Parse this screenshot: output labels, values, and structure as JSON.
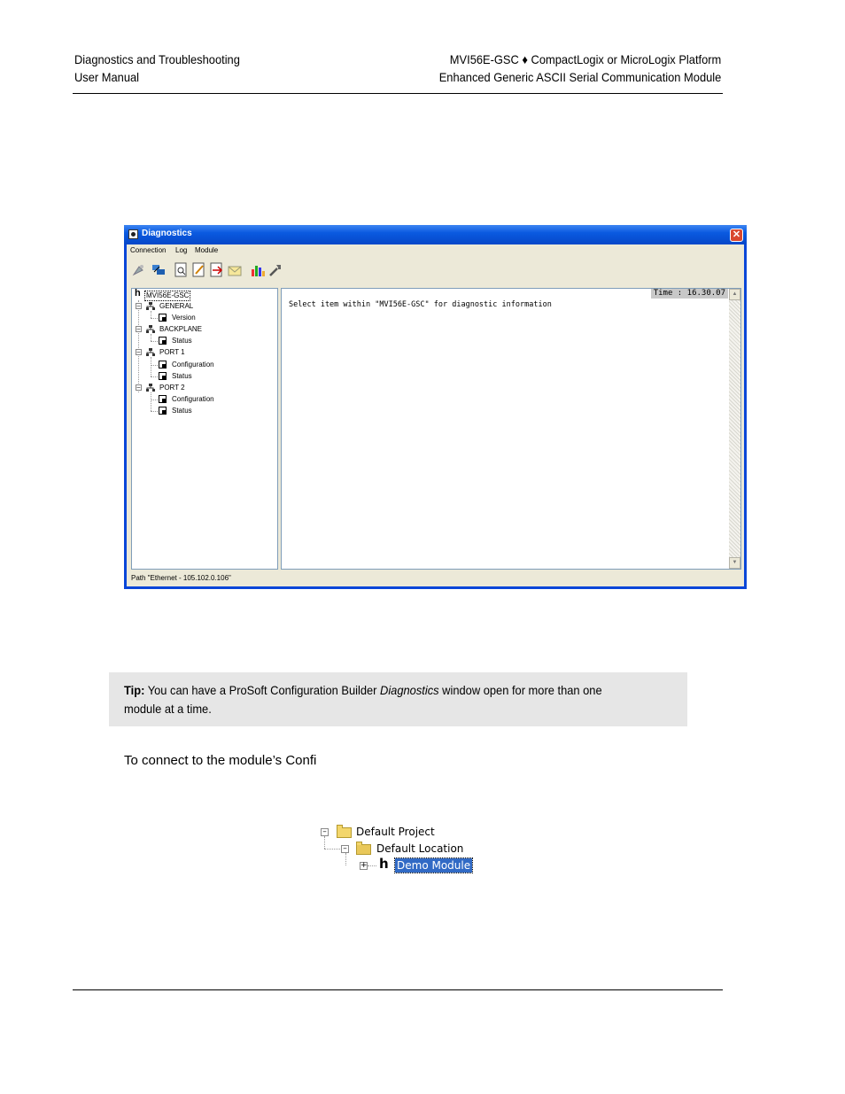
{
  "header": {
    "left_line1": "Diagnostics and Troubleshooting",
    "left_line2": "User Manual",
    "right_line1": "MVI56E-GSC ♦ CompactLogix or MicroLogix Platform",
    "right_line2": "Enhanced Generic ASCII Serial Communication Module"
  },
  "window": {
    "title": "Diagnostics",
    "close": "✕",
    "menu": [
      "Connection",
      "Log",
      "Module"
    ],
    "toolbar_icons": [
      "connect-icon",
      "disconnect-icon",
      "zoom-icon",
      "edit-icon",
      "transfer-icon",
      "mail-icon",
      "bar-chart-icon",
      "tools-icon"
    ],
    "tree": {
      "root": "MVI56E-GSC",
      "nodes": [
        {
          "label": "GENERAL",
          "children": [
            "Version"
          ]
        },
        {
          "label": "BACKPLANE",
          "children": [
            "Status"
          ]
        },
        {
          "label": "PORT 1",
          "children": [
            "Configuration",
            "Status"
          ]
        },
        {
          "label": "PORT 2",
          "children": [
            "Configuration",
            "Status"
          ]
        }
      ]
    },
    "content_message": "Select item within \"MVI56E-GSC\" for diagnostic information",
    "time_label": "Time : 16.30.07",
    "status_path": "Path \"Ethernet - 105.102.0.106\""
  },
  "tip": {
    "label": "Tip:",
    "text_before": " You can have a ProSoft Configuration Builder ",
    "italic": "Diagnostics",
    "text_after": " window open for more than one module at a time."
  },
  "body_text": "To connect to the module’s Confi",
  "project_tree": {
    "project": "Default Project",
    "location": "Default Location",
    "module": "Demo Module"
  }
}
